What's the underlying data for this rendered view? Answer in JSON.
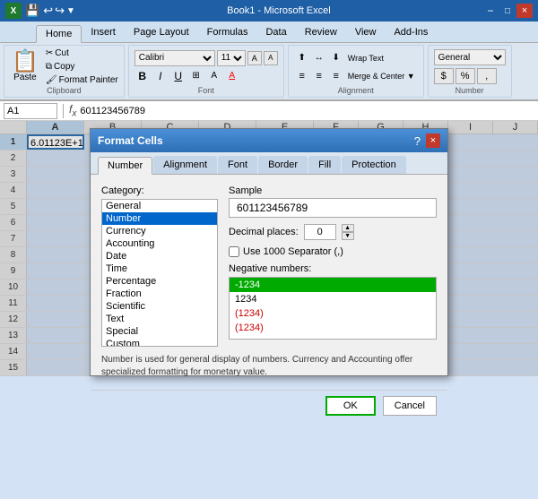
{
  "titleBar": {
    "appName": "Microsoft Excel",
    "fileName": "Book1 - Microsoft Excel",
    "winBtns": [
      "−",
      "□",
      "×"
    ]
  },
  "qaToolbar": {
    "buttons": [
      "↩",
      "↪",
      "▼"
    ]
  },
  "ribbon": {
    "tabs": [
      "Home",
      "Insert",
      "Page Layout",
      "Formulas",
      "Data",
      "Review",
      "View",
      "Add-Ins"
    ],
    "activeTab": "Home",
    "groups": {
      "clipboard": {
        "title": "Clipboard",
        "paste": "Paste",
        "cut": "Cut",
        "copy": "Copy",
        "formatPainter": "Format Painter"
      },
      "font": {
        "title": "Font",
        "fontName": "Calibri",
        "fontSize": "11",
        "bold": "B",
        "italic": "I",
        "underline": "U"
      },
      "alignment": {
        "title": "Alignment",
        "wrapText": "Wrap Text",
        "mergeCenter": "Merge & Center ▼"
      },
      "number": {
        "title": "Number",
        "format": "General",
        "dollar": "$",
        "percent": "%",
        "comma": ","
      }
    }
  },
  "formulaBar": {
    "nameBox": "A1",
    "formula": "601123456789"
  },
  "spreadsheet": {
    "colHeaders": [
      "A",
      "B",
      "C",
      "D",
      "E",
      "F",
      "G",
      "H",
      "I",
      "J"
    ],
    "rows": [
      {
        "num": 1,
        "cells": [
          {
            "val": "6.01123E+11",
            "active": true
          },
          "",
          "",
          "",
          "",
          "",
          "",
          "",
          "",
          ""
        ]
      },
      {
        "num": 2,
        "cells": [
          "",
          "",
          "",
          "",
          "",
          "",
          "",
          "",
          "",
          ""
        ]
      },
      {
        "num": 3,
        "cells": [
          "",
          "",
          "",
          "",
          "",
          "",
          "",
          "",
          "",
          ""
        ]
      },
      {
        "num": 4,
        "cells": [
          "",
          "",
          "",
          "",
          "",
          "",
          "",
          "",
          "",
          ""
        ]
      },
      {
        "num": 5,
        "cells": [
          "",
          "",
          "",
          "",
          "",
          "",
          "",
          "",
          "",
          ""
        ]
      },
      {
        "num": 6,
        "cells": [
          "",
          "",
          "",
          "",
          "",
          "",
          "",
          "",
          "",
          ""
        ]
      },
      {
        "num": 7,
        "cells": [
          "",
          "",
          "",
          "",
          "",
          "",
          "",
          "",
          "",
          ""
        ]
      },
      {
        "num": 8,
        "cells": [
          "",
          "",
          "",
          "",
          "",
          "",
          "",
          "",
          "",
          ""
        ]
      },
      {
        "num": 9,
        "cells": [
          "",
          "",
          "",
          "",
          "",
          "",
          "",
          "",
          "",
          ""
        ]
      },
      {
        "num": 10,
        "cells": [
          "",
          "",
          "",
          "",
          "",
          "",
          "",
          "",
          "",
          ""
        ]
      },
      {
        "num": 11,
        "cells": [
          "",
          "",
          "",
          "",
          "",
          "",
          "",
          "",
          "",
          ""
        ]
      },
      {
        "num": 12,
        "cells": [
          "",
          "",
          "",
          "",
          "",
          "",
          "",
          "",
          "",
          ""
        ]
      },
      {
        "num": 13,
        "cells": [
          "",
          "",
          "",
          "",
          "",
          "",
          "",
          "",
          "",
          ""
        ]
      },
      {
        "num": 14,
        "cells": [
          "",
          "",
          "",
          "",
          "",
          "",
          "",
          "",
          "",
          ""
        ]
      },
      {
        "num": 15,
        "cells": [
          "",
          "",
          "",
          "",
          "",
          "",
          "",
          "",
          "",
          ""
        ]
      }
    ]
  },
  "dialog": {
    "title": "Format Cells",
    "tabs": [
      "Number",
      "Alignment",
      "Font",
      "Border",
      "Fill",
      "Protection"
    ],
    "activeTab": "Number",
    "categoryLabel": "Category:",
    "categories": [
      "General",
      "Number",
      "Currency",
      "Accounting",
      "Date",
      "Time",
      "Percentage",
      "Fraction",
      "Scientific",
      "Text",
      "Special",
      "Custom"
    ],
    "selectedCategory": "Number",
    "sampleLabel": "Sample",
    "sampleValue": "601123456789",
    "decimalLabel": "Decimal places:",
    "decimalValue": "0",
    "thousandSepLabel": "Use 1000 Separator (,)",
    "negLabel": "Negative numbers:",
    "negOptions": [
      "-1234",
      "1234",
      "(1234)",
      "(1234)"
    ],
    "negSelected": "-1234",
    "description": "Number is used for general display of numbers.  Currency and Accounting offer specialized formatting for monetary value.",
    "okLabel": "OK",
    "cancelLabel": "Cancel"
  }
}
